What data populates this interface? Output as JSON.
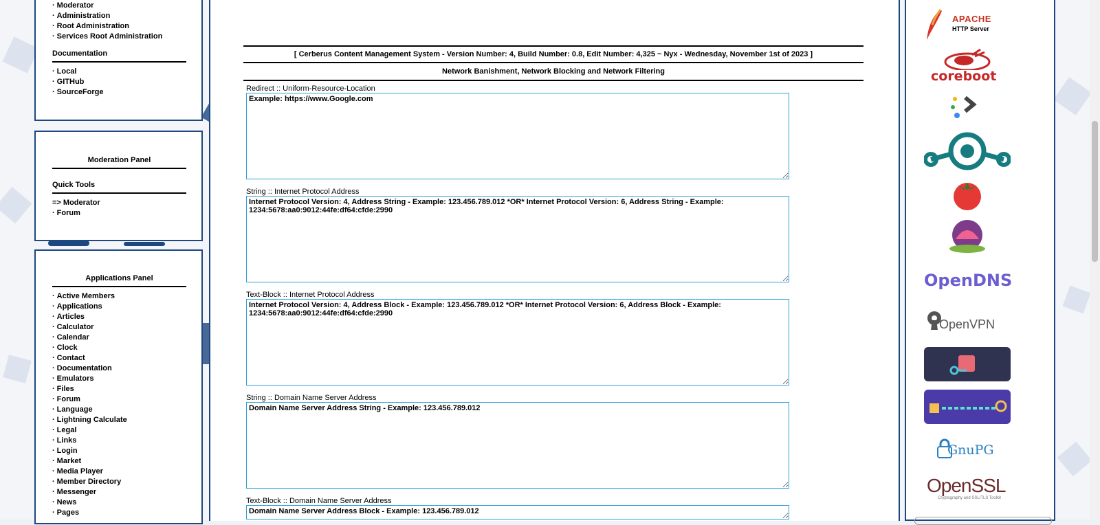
{
  "sidebar": {
    "admin_links": [
      "Moderator",
      "Administration",
      "Root Administration",
      "Services Root Administration"
    ],
    "documentation": {
      "title": "Documentation",
      "links": [
        "Local",
        "GITHub",
        "SourceForge"
      ]
    },
    "moderation_panel": {
      "title": "Moderation Panel",
      "quick_tools_title": "Quick Tools",
      "links": [
        "=> Moderator",
        "Forum"
      ]
    },
    "applications_panel": {
      "title": "Applications Panel",
      "links": [
        "Active Members",
        "Applications",
        "Articles",
        "Calculator",
        "Calendar",
        "Clock",
        "Contact",
        "Documentation",
        "Emulators",
        "Files",
        "Forum",
        "Language",
        "Lightning Calculate",
        "Legal",
        "Links",
        "Login",
        "Market",
        "Media Player",
        "Member Directory",
        "Messenger",
        "News",
        "Pages"
      ]
    },
    "bullet": "·"
  },
  "main": {
    "icons": [
      "user-settings-icon",
      "monitor-icon",
      "network-computers-icon",
      "user-lock-icon"
    ],
    "version_banner": "[ Cerberus Content Management System - Version Number: 4, Build Number: 0.8, Edit Number: 4,325 ~ Nyx - Wednesday, November 1st of 2023 ]",
    "section_title": "Network Banishment, Network Blocking and Network Filtering",
    "fields": [
      {
        "label": "Redirect :: Uniform-Resource-Location",
        "placeholder": "Example: https://www.Google.com"
      },
      {
        "label": "String :: Internet Protocol Address",
        "placeholder": "Internet Protocol Version: 4, Address String - Example: 123.456.789.012 *OR* Internet Protocol Version: 6, Address String - Example: 1234:5678:aa0:9012:44fe:df64:cfde:2990"
      },
      {
        "label": "Text-Block :: Internet Protocol Address",
        "placeholder": "Internet Protocol Version: 4, Address Block - Example: 123.456.789.012 *OR* Internet Protocol Version: 6, Address Block - Example: 1234:5678:aa0:9012:44fe:df64:cfde:2990"
      },
      {
        "label": "String :: Domain Name Server Address",
        "placeholder": "Domain Name Server Address String - Example: 123.456.789.012"
      },
      {
        "label": "Text-Block :: Domain Name Server Address",
        "placeholder": "Domain Name Server Address Block - Example: 123.456.789.012"
      }
    ]
  },
  "right_logos": {
    "apache": {
      "title": "APACHE",
      "subtitle": "HTTP Server"
    },
    "coreboot": "coreboot",
    "opendns": "OpenDNS",
    "openvpn": "OpenVPN",
    "gnupg": "GnuPG",
    "openssl": {
      "title": "OpenSSL",
      "subtitle": "Cryptography and SSL/TLS Toolkit"
    }
  },
  "colors": {
    "border": "#1d4780",
    "field_border": "#2aa0d8",
    "opendns": "#6a5ed0",
    "coreboot": "#c62828"
  }
}
